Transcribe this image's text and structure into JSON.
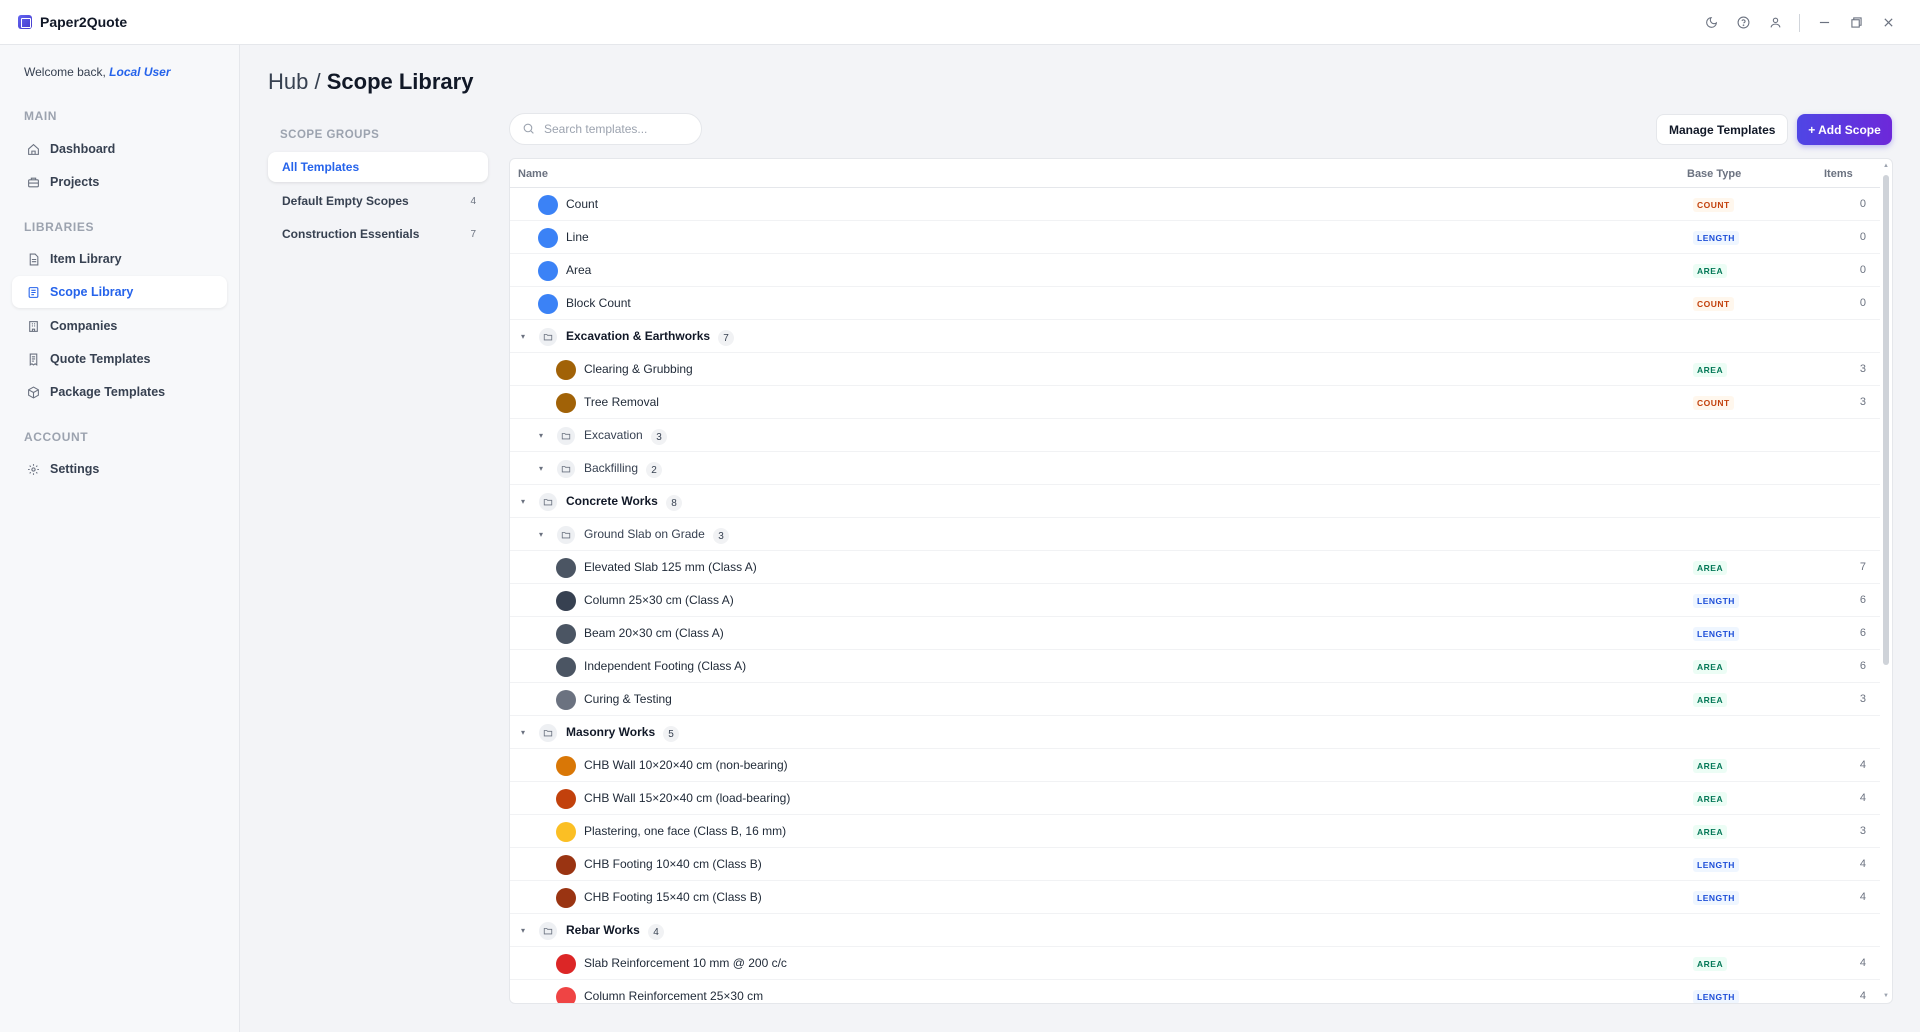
{
  "app": {
    "title": "Paper2Quote"
  },
  "sidebar": {
    "welcome_prefix": "Welcome back, ",
    "welcome_user": "Local User",
    "sections": {
      "main": "MAIN",
      "libraries": "LIBRARIES",
      "account": "ACCOUNT"
    },
    "items": {
      "dashboard": "Dashboard",
      "projects": "Projects",
      "item_library": "Item Library",
      "scope_library": "Scope Library",
      "companies": "Companies",
      "quote_templates": "Quote Templates",
      "package_templates": "Package Templates",
      "settings": "Settings"
    }
  },
  "breadcrumb": {
    "parent": "Hub /",
    "current": "Scope Library"
  },
  "scope_groups": {
    "title": "SCOPE GROUPS",
    "items": [
      {
        "label": "All Templates",
        "count": ""
      },
      {
        "label": "Default Empty Scopes",
        "count": "4"
      },
      {
        "label": "Construction Essentials",
        "count": "7"
      }
    ]
  },
  "search": {
    "placeholder": "Search templates..."
  },
  "toolbar": {
    "manage_label": "Manage Templates",
    "add_label": "+ Add Scope"
  },
  "table": {
    "headers": {
      "name": "Name",
      "base_type": "Base Type",
      "items": "Items"
    },
    "rows": [
      {
        "kind": "item",
        "level": 0,
        "name": "Count",
        "color": "#3b82f6",
        "type": "COUNT",
        "items": "0"
      },
      {
        "kind": "item",
        "level": 0,
        "name": "Line",
        "color": "#3b82f6",
        "type": "LENGTH",
        "items": "0"
      },
      {
        "kind": "item",
        "level": 0,
        "name": "Area",
        "color": "#3b82f6",
        "type": "AREA",
        "items": "0"
      },
      {
        "kind": "item",
        "level": 0,
        "name": "Block Count",
        "color": "#3b82f6",
        "type": "COUNT",
        "items": "0"
      },
      {
        "kind": "group",
        "level": 0,
        "name": "Excavation & Earthworks",
        "count": "7"
      },
      {
        "kind": "item",
        "level": 1,
        "name": "Clearing & Grubbing",
        "color": "#a16207",
        "type": "AREA",
        "items": "3"
      },
      {
        "kind": "item",
        "level": 1,
        "name": "Tree Removal",
        "color": "#a16207",
        "type": "COUNT",
        "items": "3"
      },
      {
        "kind": "subgroup",
        "level": 1,
        "name": "Excavation",
        "count": "3"
      },
      {
        "kind": "subgroup",
        "level": 1,
        "name": "Backfilling",
        "count": "2"
      },
      {
        "kind": "group",
        "level": 0,
        "name": "Concrete Works",
        "count": "8"
      },
      {
        "kind": "subgroup",
        "level": 1,
        "name": "Ground Slab on Grade",
        "count": "3"
      },
      {
        "kind": "item",
        "level": 1,
        "name": "Elevated Slab 125 mm (Class A)",
        "color": "#4b5563",
        "type": "AREA",
        "items": "7"
      },
      {
        "kind": "item",
        "level": 1,
        "name": "Column 25×30 cm (Class A)",
        "color": "#374151",
        "type": "LENGTH",
        "items": "6"
      },
      {
        "kind": "item",
        "level": 1,
        "name": "Beam 20×30 cm (Class A)",
        "color": "#4b5563",
        "type": "LENGTH",
        "items": "6"
      },
      {
        "kind": "item",
        "level": 1,
        "name": "Independent Footing (Class A)",
        "color": "#4b5563",
        "type": "AREA",
        "items": "6"
      },
      {
        "kind": "item",
        "level": 1,
        "name": "Curing & Testing",
        "color": "#6b7280",
        "type": "AREA",
        "items": "3"
      },
      {
        "kind": "group",
        "level": 0,
        "name": "Masonry Works",
        "count": "5"
      },
      {
        "kind": "item",
        "level": 1,
        "name": "CHB Wall 10×20×40 cm (non-bearing)",
        "color": "#d97706",
        "type": "AREA",
        "items": "4"
      },
      {
        "kind": "item",
        "level": 1,
        "name": "CHB Wall 15×20×40 cm (load-bearing)",
        "color": "#c2410c",
        "type": "AREA",
        "items": "4"
      },
      {
        "kind": "item",
        "level": 1,
        "name": "Plastering, one face (Class B, 16 mm)",
        "color": "#fbbf24",
        "type": "AREA",
        "items": "3"
      },
      {
        "kind": "item",
        "level": 1,
        "name": "CHB Footing 10×40 cm (Class B)",
        "color": "#9a3412",
        "type": "LENGTH",
        "items": "4"
      },
      {
        "kind": "item",
        "level": 1,
        "name": "CHB Footing 15×40 cm (Class B)",
        "color": "#9a3412",
        "type": "LENGTH",
        "items": "4"
      },
      {
        "kind": "group",
        "level": 0,
        "name": "Rebar Works",
        "count": "4"
      },
      {
        "kind": "item",
        "level": 1,
        "name": "Slab Reinforcement 10 mm @ 200 c/c",
        "color": "#dc2626",
        "type": "AREA",
        "items": "4"
      },
      {
        "kind": "item",
        "level": 1,
        "name": "Column Reinforcement 25×30 cm",
        "color": "#ef4444",
        "type": "LENGTH",
        "items": "4"
      }
    ]
  }
}
